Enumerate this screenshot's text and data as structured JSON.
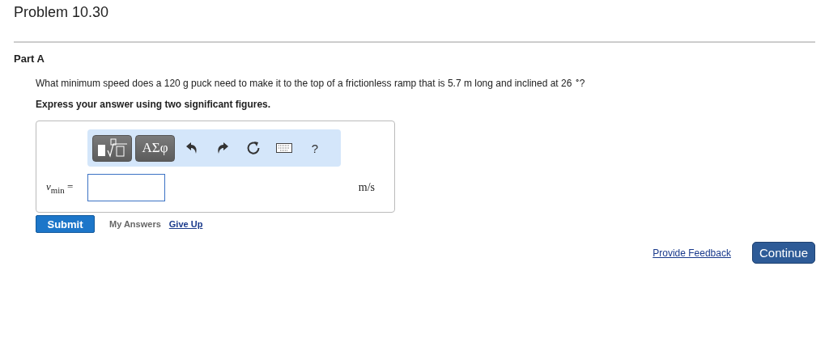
{
  "title": "Problem 10.30",
  "part": {
    "heading": "Part A",
    "question": "What minimum speed does a 120  g puck need to make it to the top of a frictionless ramp that is 5.7  m long and inclined at 26 $^{∘}$?",
    "instruction": "Express your answer using two significant figures.",
    "answer": {
      "toolbar": [
        {
          "kind": "templates"
        },
        {
          "kind": "text",
          "label": "ΑΣφ"
        },
        {
          "kind": "undo"
        },
        {
          "kind": "redo"
        },
        {
          "kind": "reset"
        },
        {
          "kind": "keyboard"
        },
        {
          "kind": "help",
          "label": "?"
        }
      ],
      "label": "*v*$_{min}$ =",
      "unit": "m/s"
    },
    "actions": {
      "submit": "Submit",
      "my_answers": "My Answers",
      "give_up": "Give Up"
    }
  },
  "footer": {
    "feedback": "Provide Feedback",
    "continue": "Continue"
  }
}
